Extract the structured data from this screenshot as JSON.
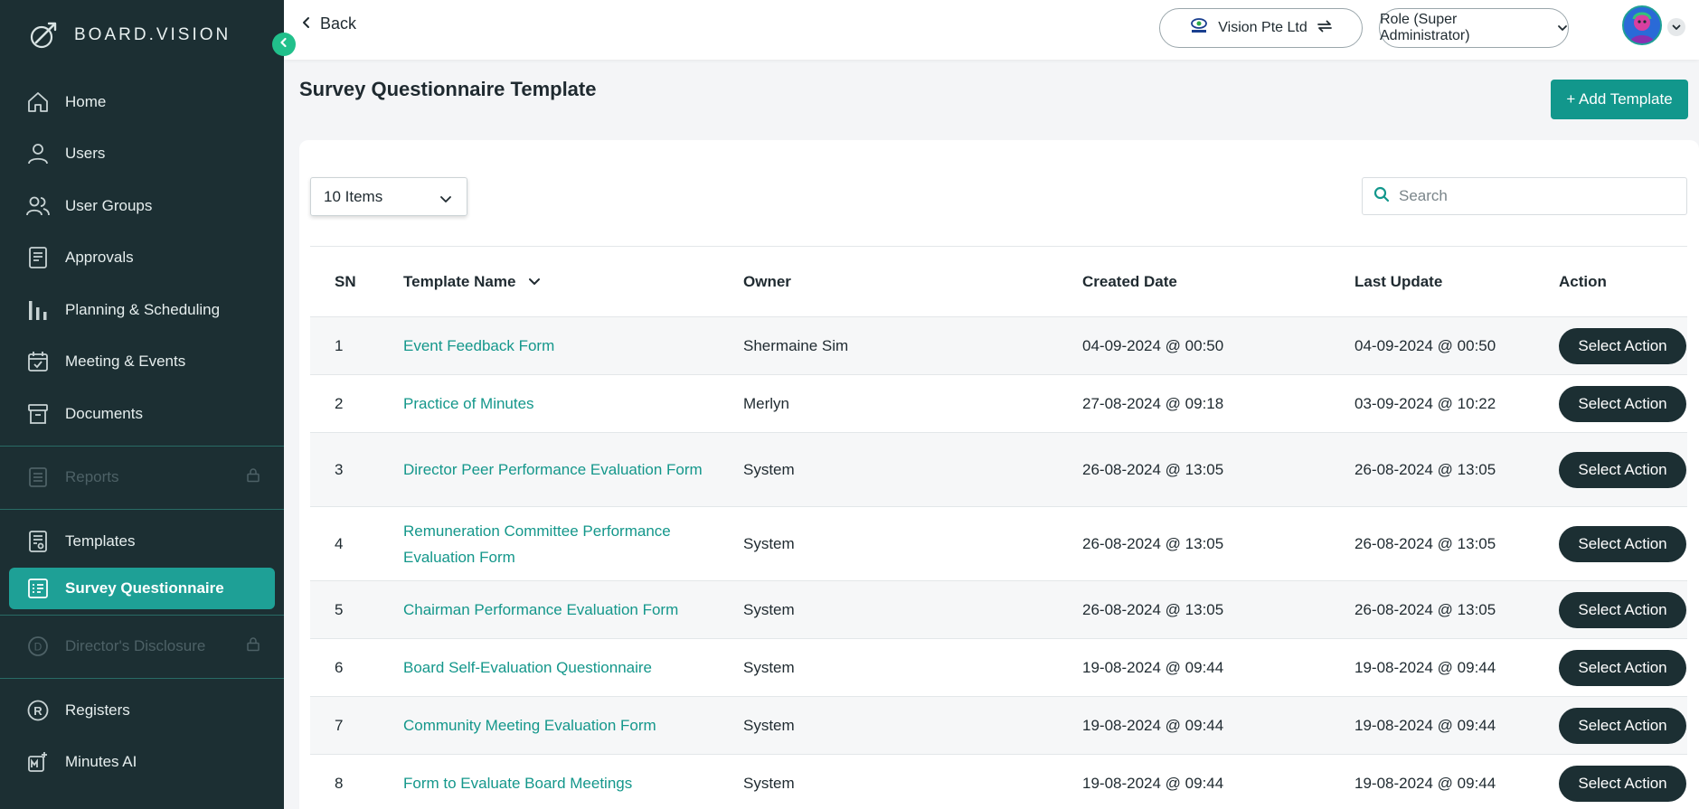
{
  "brand": {
    "name": "BOARD.VISION"
  },
  "sidebar": {
    "items": [
      {
        "label": "Home",
        "icon": "home-icon"
      },
      {
        "label": "Users",
        "icon": "user-icon"
      },
      {
        "label": "User Groups",
        "icon": "users-icon"
      },
      {
        "label": "Approvals",
        "icon": "approvals-icon"
      },
      {
        "label": "Planning & Scheduling",
        "icon": "bar-chart-icon"
      },
      {
        "label": "Meeting & Events",
        "icon": "calendar-check-icon"
      },
      {
        "label": "Documents",
        "icon": "archive-icon"
      },
      {
        "label": "Reports",
        "icon": "reports-icon",
        "disabled": true
      },
      {
        "label": "Templates",
        "icon": "template-icon"
      },
      {
        "label": "Survey Questionnaire",
        "icon": "survey-icon",
        "active": true
      },
      {
        "label": "Director's Disclosure",
        "icon": "disclosure-icon",
        "disabled": true
      },
      {
        "label": "Registers",
        "icon": "registered-icon"
      },
      {
        "label": "Minutes AI",
        "icon": "minutes-ai-icon"
      }
    ]
  },
  "topbar": {
    "back_label": "Back",
    "org_label": "Vision Pte Ltd",
    "role_label": "Role (Super Administrator)"
  },
  "page": {
    "title": "Survey Questionnaire Template",
    "add_label": "+ Add Template"
  },
  "controls": {
    "page_size": "10 Items",
    "search_placeholder": "Search"
  },
  "table": {
    "headers": {
      "sn": "SN",
      "name": "Template Name",
      "owner": "Owner",
      "created": "Created Date",
      "updated": "Last Update",
      "action": "Action"
    },
    "rows": [
      {
        "sn": "1",
        "name": "Event Feedback Form",
        "owner": "Shermaine Sim",
        "created": "04-09-2024 @ 00:50",
        "updated": "04-09-2024 @ 00:50",
        "action": "Select Action"
      },
      {
        "sn": "2",
        "name": "Practice of Minutes",
        "owner": "Merlyn",
        "created": "27-08-2024 @ 09:18",
        "updated": "03-09-2024 @ 10:22",
        "action": "Select Action"
      },
      {
        "sn": "3",
        "name": "Director Peer Performance Evaluation Form",
        "owner": "System",
        "created": "26-08-2024 @ 13:05",
        "updated": "26-08-2024 @ 13:05",
        "action": "Select Action"
      },
      {
        "sn": "4",
        "name": "Remuneration Committee Performance Evaluation Form",
        "owner": "System",
        "created": "26-08-2024 @ 13:05",
        "updated": "26-08-2024 @ 13:05",
        "action": "Select Action"
      },
      {
        "sn": "5",
        "name": "Chairman Performance Evaluation Form",
        "owner": "System",
        "created": "26-08-2024 @ 13:05",
        "updated": "26-08-2024 @ 13:05",
        "action": "Select Action"
      },
      {
        "sn": "6",
        "name": "Board Self-Evaluation Questionnaire",
        "owner": "System",
        "created": "19-08-2024 @ 09:44",
        "updated": "19-08-2024 @ 09:44",
        "action": "Select Action"
      },
      {
        "sn": "7",
        "name": "Community Meeting Evaluation Form",
        "owner": "System",
        "created": "19-08-2024 @ 09:44",
        "updated": "19-08-2024 @ 09:44",
        "action": "Select Action"
      },
      {
        "sn": "8",
        "name": "Form to Evaluate Board Meetings",
        "owner": "System",
        "created": "19-08-2024 @ 09:44",
        "updated": "19-08-2024 @ 09:44",
        "action": "Select Action"
      }
    ]
  },
  "colors": {
    "sidebar_bg": "#1c2f33",
    "accent": "#12978c",
    "active_item": "#1ea096",
    "link": "#14978b",
    "collapse_button": "#21c08b"
  }
}
